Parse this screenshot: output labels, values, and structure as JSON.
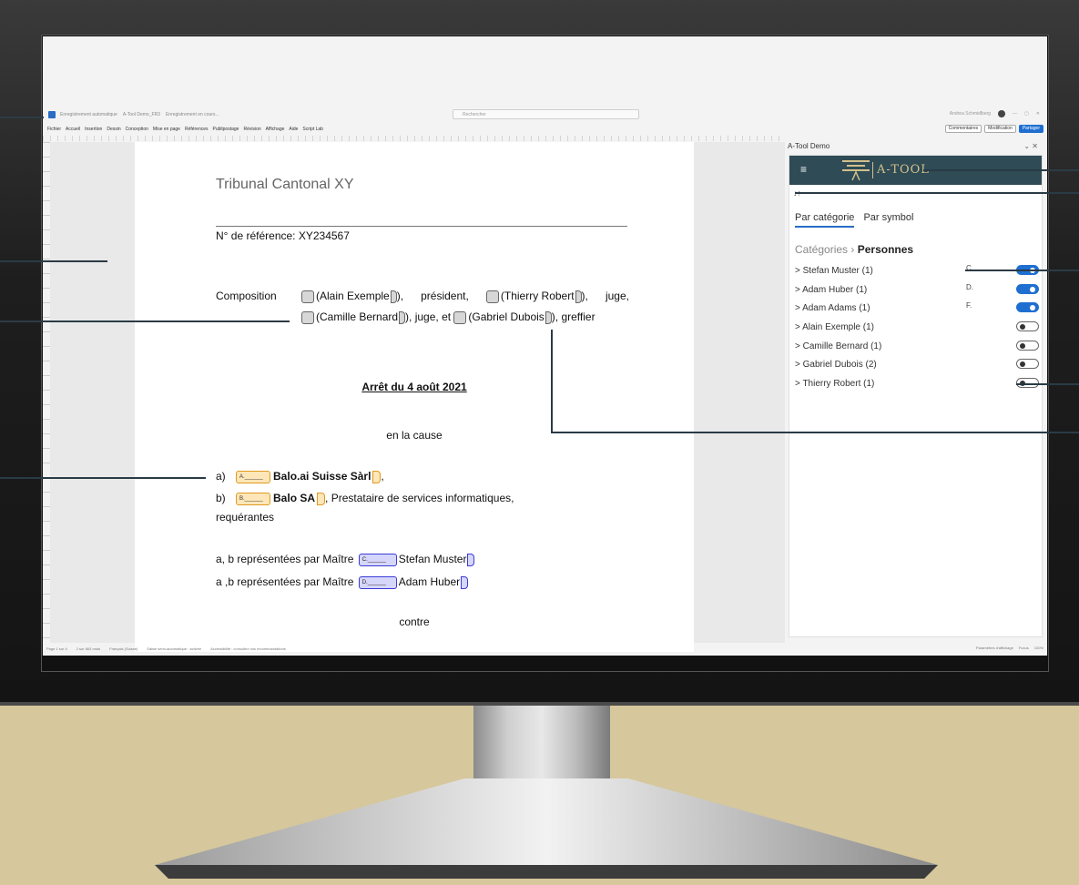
{
  "word": {
    "titlebar": {
      "autosave": "Enregistrement automatique",
      "doc_name": "A-Tool Demo_FR3",
      "saved_state": "Enregistrement en cours...",
      "search_placeholder": "Rechercher",
      "user": "Andrea Schmidlberg"
    },
    "ribbon": {
      "tabs": [
        "Fichier",
        "Accueil",
        "Insertion",
        "Dessin",
        "Conception",
        "Mise en page",
        "Références",
        "Publipostage",
        "Révision",
        "Affichage",
        "Aide",
        "Script Lab"
      ],
      "comments": "Commentaires",
      "editing": "Modification",
      "share": "Partager"
    },
    "status": {
      "page": "Page 1 sur 4",
      "words": "2 sur 663 mots",
      "language": "Français (Suisse)",
      "autocomplete": "Saisie semi-automatique : activée",
      "accessibility": "Accessibilité : consultez nos recommandations",
      "display": "Paramètres d'affichage",
      "focus": "Focus",
      "zoom": "100%"
    }
  },
  "document": {
    "court": "Tribunal Cantonal XY",
    "reference": "N° de référence: XY234567",
    "composition_label": "Composition",
    "composition": {
      "p1": "Alain Exemple",
      "r1": "président,",
      "p2": "Thierry Robert",
      "r2": "juge,",
      "p3": "Camille Bernard",
      "r3": ", juge, et",
      "p4": "Gabriel Dubois",
      "r4": ", greffier"
    },
    "arret": "Arrêt du 4 août 2021",
    "en_la_cause": "en la cause",
    "parties": [
      {
        "label": "a)",
        "tag": "A.______",
        "name": "Balo.ai Suisse Sàrl",
        "suffix": ","
      },
      {
        "label": "b)",
        "tag": "B.______",
        "name": "Balo SA",
        "suffix": ", Prestataire de services informatiques,"
      }
    ],
    "requerantes": "requérantes",
    "representations": [
      {
        "prefix": "a, b représentées par Maître",
        "tag": "C.______",
        "name": "Stefan Muster"
      },
      {
        "prefix": "a ,b représentées par Maître",
        "tag": "D.______",
        "name": "Adam Huber"
      }
    ],
    "contre": "contre"
  },
  "pane": {
    "title": "A-Tool Demo",
    "brand": "A-TOOL",
    "menu_icon": "≡",
    "sort_icon": "↓↑",
    "tabs": [
      "Par catégorie",
      "Par symbol"
    ],
    "breadcrumb_root": "Catégories",
    "breadcrumb_sep": "›",
    "breadcrumb_current": "Personnes",
    "persons": [
      {
        "label": "> Stefan Muster (1)",
        "initial": "C.",
        "on": true
      },
      {
        "label": "> Adam Huber (1)",
        "initial": "D.",
        "on": true
      },
      {
        "label": "> Adam Adams (1)",
        "initial": "F.",
        "on": true
      },
      {
        "label": "> Alain Exemple (1)",
        "initial": "",
        "on": false
      },
      {
        "label": "> Camille Bernard (1)",
        "initial": "",
        "on": false
      },
      {
        "label": "> Gabriel Dubois (2)",
        "initial": "",
        "on": false
      },
      {
        "label": "> Thierry Robert (1)",
        "initial": "",
        "on": false
      }
    ]
  },
  "colors": {
    "accent": "#1f6fd1",
    "brand_bar": "#2e4b56",
    "brand_gold": "#d3c08a",
    "orange_tag": "#fde6b7",
    "blue_tag": "#d6d6fb",
    "background": "#d6c79c"
  }
}
